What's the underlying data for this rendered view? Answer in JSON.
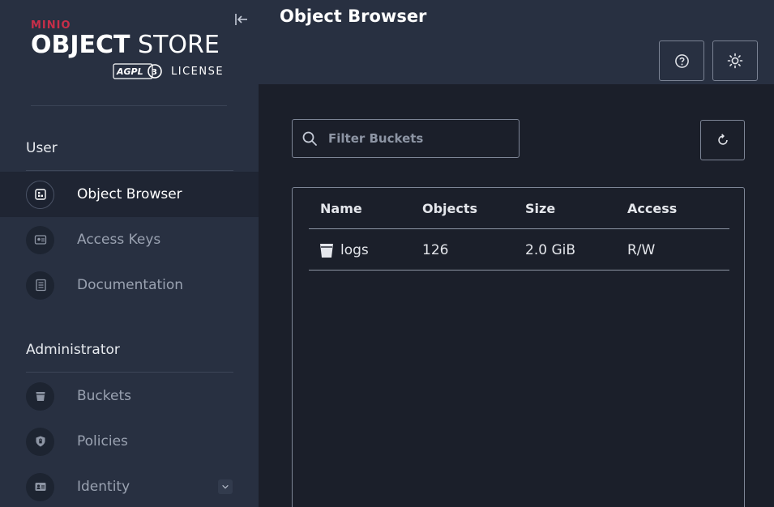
{
  "sidebar": {
    "logo": {
      "brand": "MINIO",
      "product_bold": "OBJECT",
      "product_light": " STORE",
      "agpl": "AGPLV3",
      "license": "LICENSE"
    },
    "sections": [
      {
        "title": "User"
      },
      {
        "title": "Administrator"
      }
    ],
    "user_items": [
      {
        "label": "Object Browser",
        "icon": "object-browser-icon",
        "active": true
      },
      {
        "label": "Access Keys",
        "icon": "access-keys-icon"
      },
      {
        "label": "Documentation",
        "icon": "documentation-icon"
      }
    ],
    "admin_items": [
      {
        "label": "Buckets",
        "icon": "bucket-icon"
      },
      {
        "label": "Policies",
        "icon": "shield-icon"
      },
      {
        "label": "Identity",
        "icon": "id-card-icon",
        "expandable": true
      }
    ]
  },
  "header": {
    "title": "Object Browser"
  },
  "main": {
    "filter": {
      "placeholder": "Filter Buckets",
      "value": ""
    },
    "table": {
      "columns": [
        "Name",
        "Objects",
        "Size",
        "Access"
      ],
      "rows": [
        {
          "name": "logs",
          "objects": "126",
          "size": "2.0 GiB",
          "access": "R/W"
        }
      ]
    }
  },
  "colors": {
    "sidebar_bg": "#283041",
    "main_bg": "#1b1f2a",
    "brand_red": "#c72e49"
  }
}
